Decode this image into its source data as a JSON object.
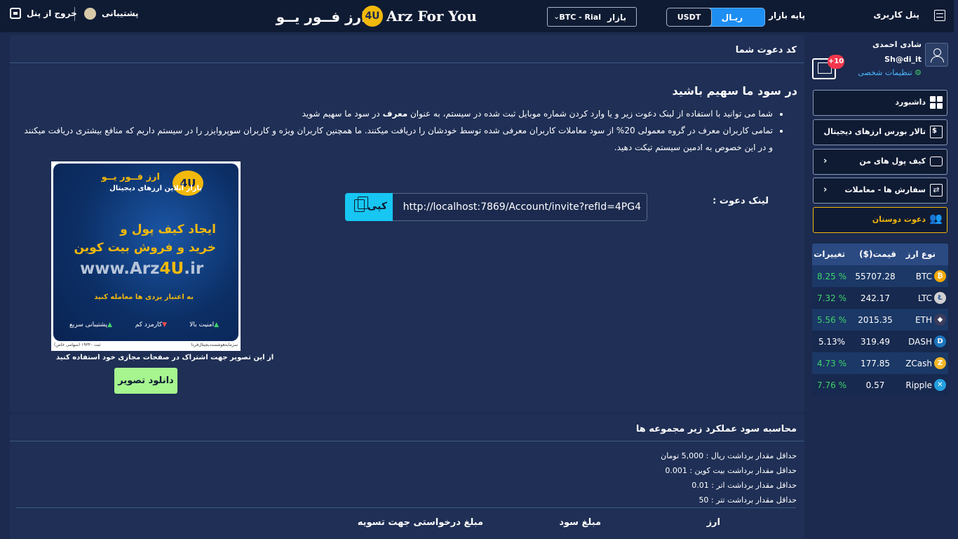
{
  "header": {
    "panel_user": "پنل کاربری",
    "market_base_label": "پایه بازار",
    "base_rial": "ریـال",
    "base_usdt": "USDT",
    "market_label": "بازار",
    "market_value": "BTC - Rial",
    "logo_fa": "ارز فــور یــو",
    "logo_badge": "4U",
    "logo_en": "Arz For You",
    "support": "پشتیبانی",
    "logout": "خروج از پنل"
  },
  "invite_card": {
    "title": "کد دعوت شما",
    "heading": "در سود ما سهیم باشید",
    "bullet1_a": "شما می توانید با استفاده از لینک دعوت زیر و یا وارد کردن شماره موبایل ثبت شده در سیستم، به عنوان ",
    "bullet1_b": "معرف",
    "bullet1_c": " در سود ما سهیم شوید",
    "bullet2": "تمامی کاربران معرف در گروه معمولی 20% از سود معاملات کاربران معرفی شده توسط خودشان را دریافت میکنند. ما همچنین کاربران ویژه و کاربران سوپروایزر را در سیستم داریم که منافع بیشتری دریافت میکنند و در این خصوص به ادمین سیستم تیکت دهید.",
    "invite_label": "لینک دعوت :",
    "invite_url": "http://localhost:7869/Account/invite?refId=4PG4",
    "copy_label": "کپی",
    "banner": {
      "logo": "4U",
      "name": "ارز فــور یــو",
      "subtitle": "بازار آنلاین ارزهای دیجیتال",
      "line1": "ایجاد کیف پول و",
      "line2": "خرید و فروش بیت کوین",
      "www_prefix": "www.Arz",
      "www_highlight": "4U",
      "www_suffix": ".ir",
      "trust": "به اعتبار یزدی ها معامله کنید",
      "feature1": "امنیت بالا",
      "feature2": "کارمزد کم",
      "feature3": "پشتیبانی سریع",
      "footer_right": "سرمایه‌هوشمند‌دیجیتال‌فردا",
      "footer_left": "ثبت ۱۹۳۴۰ (سهامی خاص)"
    },
    "banner_caption": "از این تصویر جهت اشتراک در صفحات مجازی خود استفاده کنید",
    "download_label": "دانلود تصویر"
  },
  "profit_card": {
    "title": "محاسبه سود عملکرد زیر مجموعه ها",
    "min_lines": [
      "حداقل مقدار برداشت ریال : 5,000 تومان",
      "حداقل مقدار برداشت بیت کوین : 0.001",
      "حداقل مقدار برداشت اتر : 0.01",
      "حداقل مقدار برداشت تتر : 50"
    ],
    "columns": [
      "ارز",
      "مبلغ سود",
      "مبلغ درخواستی جهت تسویه"
    ]
  },
  "sidebar": {
    "user_name": "شادی احمدی",
    "user_id": "Sh@di_it",
    "settings_label": "تنظیمات شخصی",
    "message_badge": "+10",
    "nav": [
      {
        "label": "داشبورد",
        "icon": "dashboard-icon"
      },
      {
        "label": "تالار بورس ارزهای دیجیتال",
        "icon": "bourse-icon"
      },
      {
        "label": "کیف پول های من",
        "icon": "wallet-icon"
      },
      {
        "label": "سفارش ها - معاملات",
        "icon": "swap-icon"
      },
      {
        "label": "دعوت دوستان",
        "icon": "users-icon"
      }
    ],
    "chevron": "‹"
  },
  "price_table": {
    "headers": [
      "نوع ارز",
      "قیمت($)",
      "تغییرات"
    ],
    "rows": [
      {
        "coin": "BTC",
        "price": "55707.28",
        "change": "8.25 %",
        "icon_glyph": "₿"
      },
      {
        "coin": "LTC",
        "price": "242.17",
        "change": "7.32 %",
        "icon_glyph": "Ł"
      },
      {
        "coin": "ETH",
        "price": "2015.35",
        "change": "5.56 %",
        "icon_glyph": "◆"
      },
      {
        "coin": "DASH",
        "price": "319.49",
        "change": "5.13%",
        "icon_glyph": "D"
      },
      {
        "coin": "ZCash",
        "price": "177.85",
        "change": "4.73 %",
        "icon_glyph": "Z"
      },
      {
        "coin": "Ripple",
        "price": "0.57",
        "change": "7.76 %",
        "icon_glyph": "✕"
      }
    ]
  },
  "colors": {
    "background": "#1b2a4e",
    "header": "#0f1b33",
    "accent_blue": "#1e8ef2",
    "copy_cyan": "#17c6f2",
    "gold": "#f2b90c",
    "green": "#3ed36a",
    "download_green": "#a6f58f"
  }
}
